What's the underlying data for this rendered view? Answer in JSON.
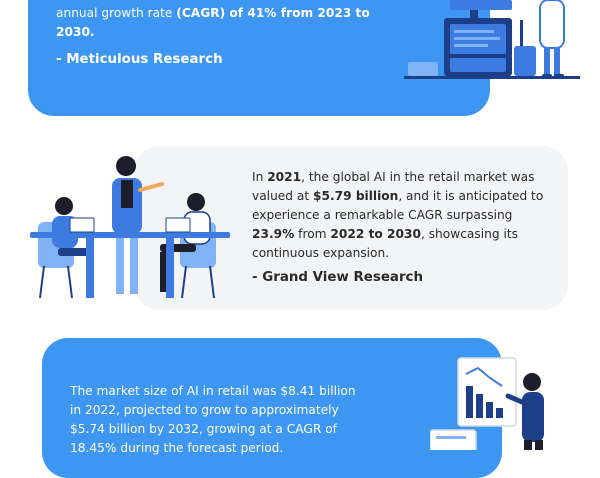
{
  "card1": {
    "text_prefix": "annual growth rate ",
    "text_bold": "(CAGR) of 41% from 2023 to 2030.",
    "source": "- Meticulous Research"
  },
  "card2": {
    "t1": "In ",
    "b1": "2021",
    "t2": ", the global AI in the retail market was valued at ",
    "b2": "$5.79 billion",
    "t3": ", and it is anticipated to experience a remarkable CAGR surpassing ",
    "b3": "23.9%",
    "t4": " from ",
    "b4": "2022 to 2030",
    "t5": ", showcasing its continuous expansion.",
    "source": "- Grand View Research"
  },
  "card3": {
    "text": "The market size of AI in retail was $8.41 billion in 2022, projected to grow to approximately $5.74 billion by 2032, growing at a CAGR of 18.45% during the forecast period."
  },
  "colors": {
    "card_blue": "#3d97f2",
    "card_grey": "#f3f4f6",
    "illus_dark_blue": "#1d3f8a",
    "illus_mid_blue": "#3d7be0",
    "illus_light_blue": "#7fb3f5"
  }
}
